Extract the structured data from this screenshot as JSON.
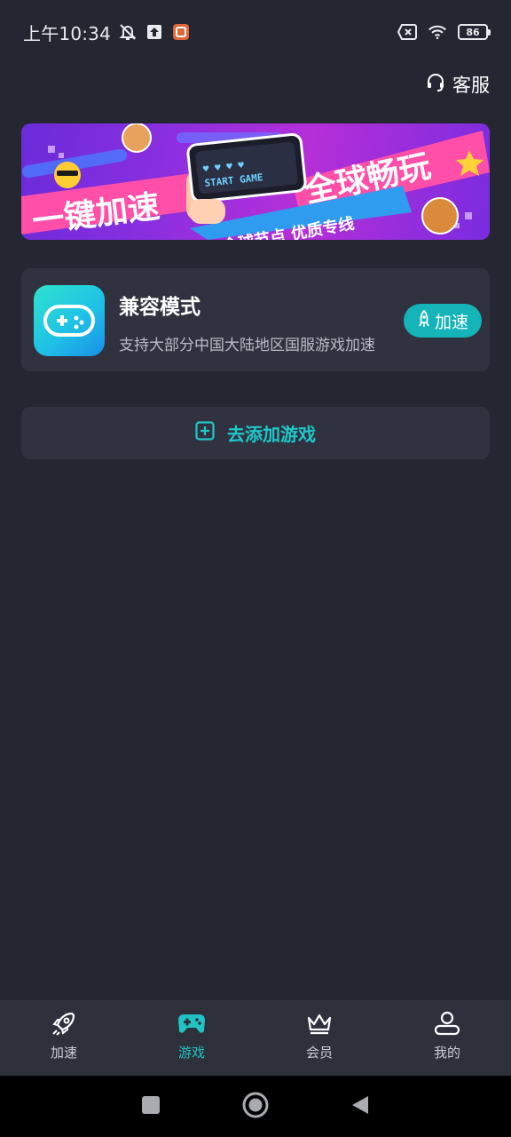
{
  "status_bar": {
    "time": "上午10:34",
    "battery": "86",
    "icons": [
      "mute-bell-icon",
      "upload-icon",
      "app-notification-icon",
      "no-sim-icon",
      "wifi-icon",
      "battery-icon"
    ]
  },
  "header": {
    "service_label": "客服",
    "service_icon": "headset-icon"
  },
  "banner": {
    "text_left": "一键加速",
    "text_right": "全球畅玩",
    "text_bottom": "全球节点 优质专线",
    "screen_text": "START GAME"
  },
  "game_card": {
    "title": "兼容模式",
    "description": "支持大部分中国大陆地区国服游戏加速",
    "button_label": "加速",
    "icon": "gamepad-icon"
  },
  "add_game": {
    "label": "去添加游戏",
    "icon": "plus-square-icon"
  },
  "bottom_nav": {
    "items": [
      {
        "label": "加速",
        "icon": "rocket-icon",
        "active": false
      },
      {
        "label": "游戏",
        "icon": "gamepad-icon",
        "active": true
      },
      {
        "label": "会员",
        "icon": "crown-icon",
        "active": false
      },
      {
        "label": "我的",
        "icon": "user-icon",
        "active": false
      }
    ]
  },
  "colors": {
    "background": "#242731",
    "card": "#30333f",
    "accent": "#1fc7c9",
    "button": "#14b4b8"
  }
}
